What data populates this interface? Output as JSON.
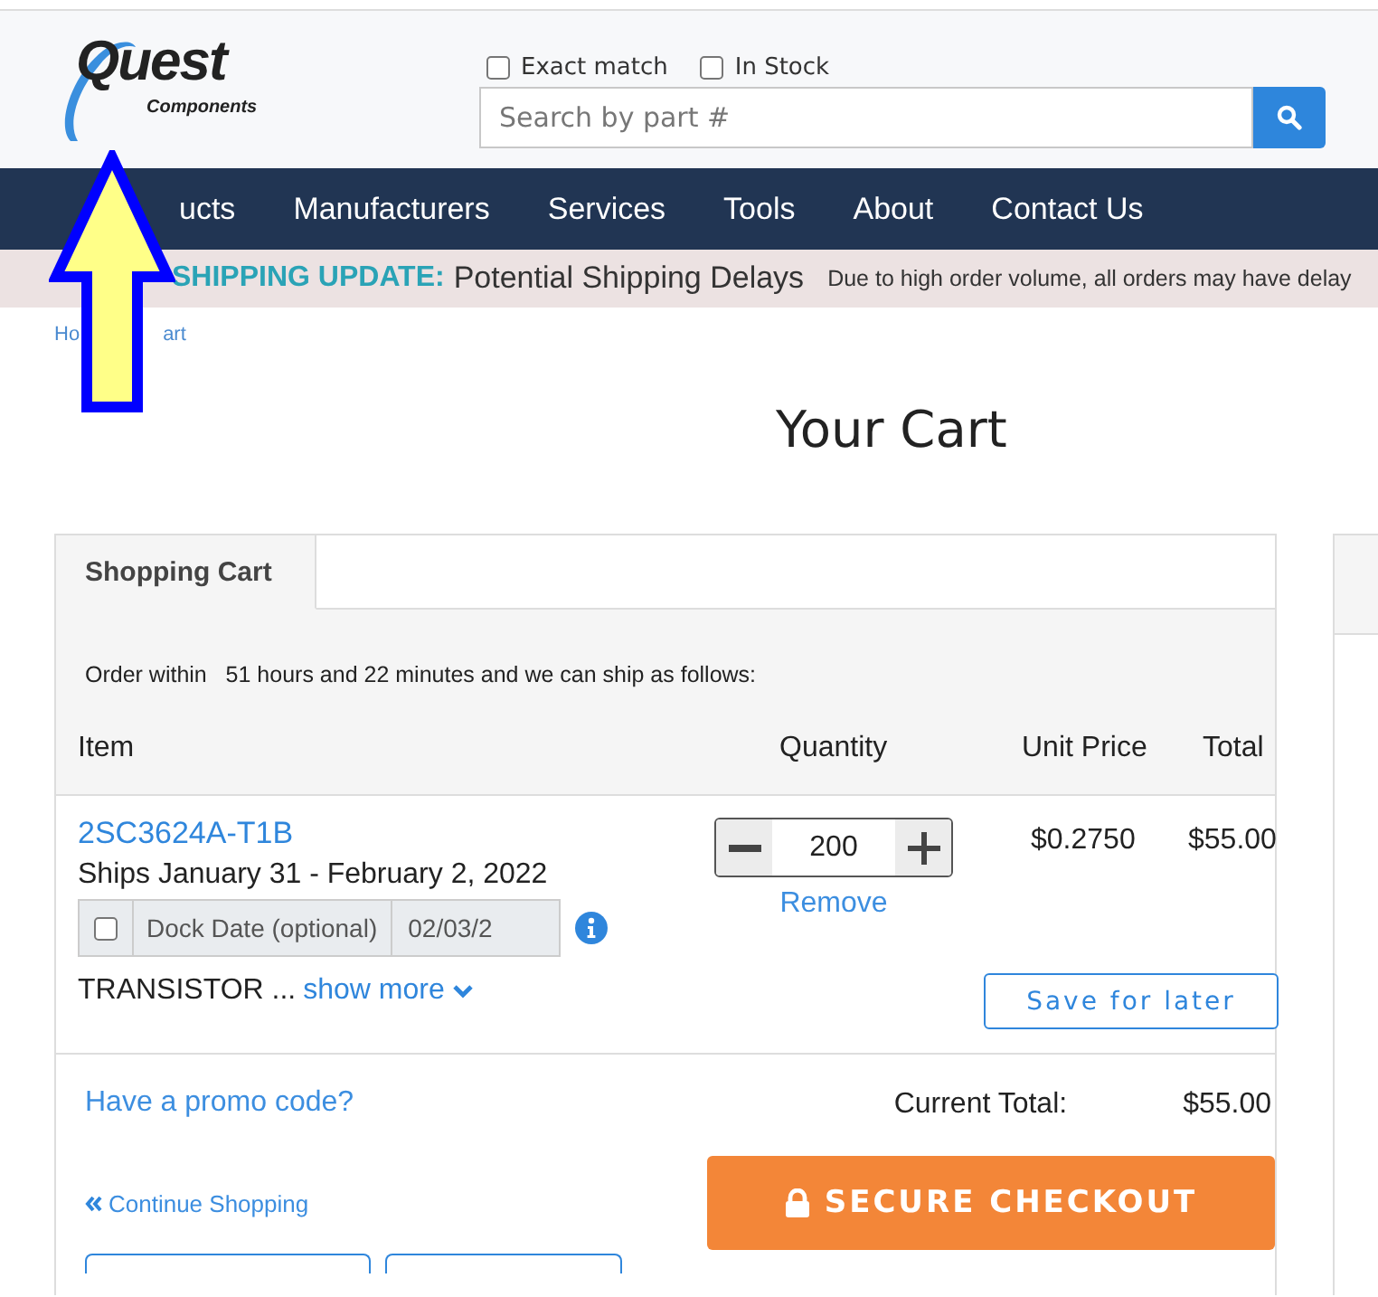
{
  "logo": {
    "name": "Quest",
    "tagline": "Components"
  },
  "search_options": [
    {
      "label": "Exact match",
      "checked": false
    },
    {
      "label": "In Stock",
      "checked": false
    }
  ],
  "search": {
    "placeholder": "Search by part #"
  },
  "nav": [
    "ucts",
    "Manufacturers",
    "Services",
    "Tools",
    "About",
    "Contact Us"
  ],
  "banner": {
    "title": "SHIPPING UPDATE:",
    "headline": "Potential Shipping Delays",
    "message": "Due to high order volume, all orders may have delay"
  },
  "breadcrumb": [
    "Ho",
    "art"
  ],
  "page_title": "Your Cart",
  "tabs": [
    {
      "label": "Shopping Cart",
      "selected": true
    }
  ],
  "notice": {
    "lead": "Order within",
    "rest": "51 hours and 22 minutes and we can ship as follows:"
  },
  "columns": [
    "Item",
    "Quantity",
    "Unit Price",
    "Total"
  ],
  "items": [
    {
      "part": "2SC3624A-T1B",
      "ships": "Ships January 31 - February 2, 2022",
      "dock_checked": false,
      "dock_label": "Dock Date (optional)",
      "dock_date": "02/03/2",
      "description": "TRANSISTOR ...",
      "show_more": "show more",
      "quantity": "200",
      "remove": "Remove",
      "unit_price": "$0.2750",
      "total": "$55.00",
      "save": "Save for later"
    }
  ],
  "promo": "Have a promo code?",
  "current_total": {
    "label": "Current Total:",
    "value": "$55.00"
  },
  "checkout": "SECURE CHECKOUT",
  "continue": "Continue Shopping"
}
